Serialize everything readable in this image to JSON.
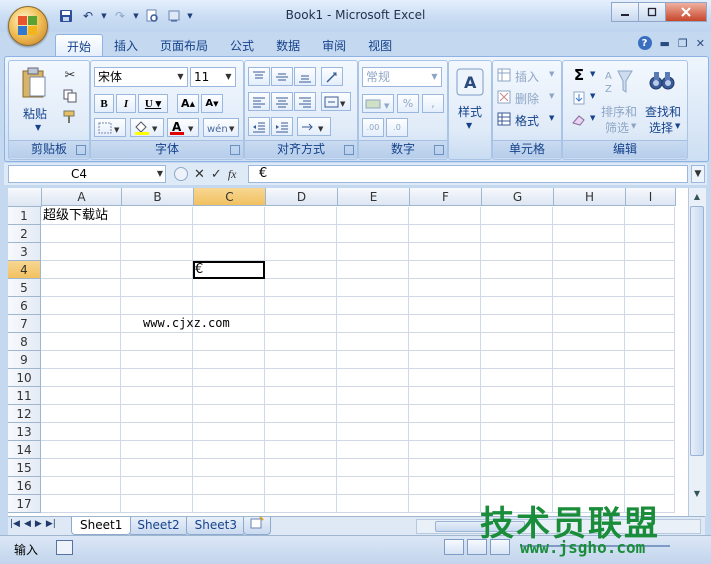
{
  "window": {
    "title": "Book1 - Microsoft Excel"
  },
  "tabs": [
    "开始",
    "插入",
    "页面布局",
    "公式",
    "数据",
    "审阅",
    "视图"
  ],
  "ribbon": {
    "clipboard": {
      "group": "剪贴板",
      "paste": "粘贴"
    },
    "font": {
      "group": "字体",
      "name": "宋体",
      "size": "11"
    },
    "alignment": {
      "group": "对齐方式"
    },
    "number": {
      "group": "数字",
      "format": "常规"
    },
    "styles": {
      "label": "样式"
    },
    "cells": {
      "group": "单元格",
      "insert": "插入",
      "delete": "删除",
      "format": "格式"
    },
    "editing": {
      "group": "编辑",
      "sort_line1": "排序和",
      "sort_line2": "筛选",
      "find_line1": "查找和",
      "find_line2": "选择"
    }
  },
  "formula_bar": {
    "name_box": "C4",
    "content": "€"
  },
  "grid": {
    "columns": [
      "A",
      "B",
      "C",
      "D",
      "E",
      "F",
      "G",
      "H",
      "I"
    ],
    "rows": [
      "1",
      "2",
      "3",
      "4",
      "5",
      "6",
      "7",
      "8",
      "9",
      "10",
      "11",
      "12",
      "13",
      "14",
      "15",
      "16",
      "17"
    ],
    "selected_column": "C",
    "selected_row": "4",
    "cells": {
      "A1": "超级下载站",
      "C4": "€",
      "B7": "www.cjxz.com"
    }
  },
  "sheets": [
    "Sheet1",
    "Sheet2",
    "Sheet3"
  ],
  "active_sheet": "Sheet1",
  "status": {
    "mode": "输入"
  },
  "watermark": {
    "text": "技术员联盟",
    "url": "www.jsgho.com"
  }
}
